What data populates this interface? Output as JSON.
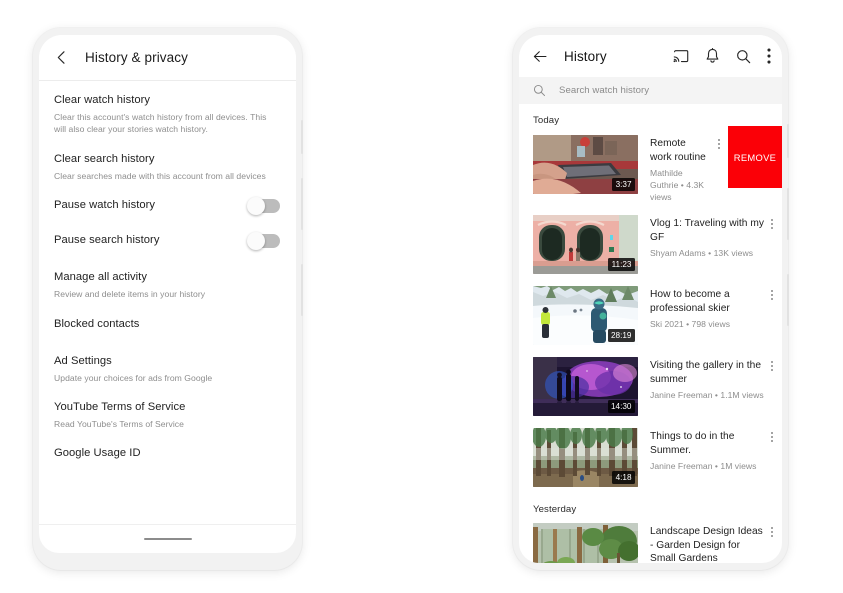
{
  "left_phone": {
    "header": {
      "title": "History & privacy",
      "back_icon": "back-chevron-icon"
    },
    "settings": [
      {
        "title": "Clear watch history",
        "subtitle": "Clear this account's watch history from all devices. This will also clear your stories watch history.",
        "control": "none"
      },
      {
        "title": "Clear search history",
        "subtitle": "Clear searches made with this account from all devices",
        "control": "none"
      },
      {
        "title": "Pause watch history",
        "subtitle": "",
        "control": "toggle",
        "toggle_on": false
      },
      {
        "title": "Pause search history",
        "subtitle": "",
        "control": "toggle",
        "toggle_on": false
      },
      {
        "title": "Manage all activity",
        "subtitle": "Review and delete items in your history",
        "control": "none"
      },
      {
        "title": "Blocked contacts",
        "subtitle": "",
        "control": "none"
      },
      {
        "title": "Ad Settings",
        "subtitle": "Update your choices for ads from Google",
        "control": "none"
      },
      {
        "title": "YouTube Terms of Service",
        "subtitle": "Read YouTube's Terms of Service",
        "control": "none"
      },
      {
        "title": "Google Usage ID",
        "subtitle": "",
        "control": "none"
      }
    ]
  },
  "right_phone": {
    "header": {
      "title": "History",
      "back_icon": "back-arrow-icon",
      "icons": [
        "cast-icon",
        "notifications-bell-icon",
        "search-icon",
        "overflow-menu-icon"
      ]
    },
    "search": {
      "placeholder": "Search watch history",
      "icon": "search-icon"
    },
    "sections": [
      {
        "label": "Today",
        "videos": [
          {
            "title": "Remote work routine",
            "channel": "Mathilde Guthrie",
            "views": "4.3K views",
            "meta": "Mathilde Guthrie • 4.3K views",
            "duration": "3:37",
            "swipe_action": "REMOVE",
            "swipe_action_color": "#fb0007",
            "thumb": "desk-laptop-workspace"
          },
          {
            "title": "Vlog 1: Traveling with my GF",
            "channel": "Shyam Adams",
            "views": "13K views",
            "meta": "Shyam Adams • 13K views",
            "duration": "11:23",
            "thumb": "pink-building-facade"
          },
          {
            "title": "How to become a professional skier",
            "channel": "Ski 2021",
            "views": "798 views",
            "meta": "Ski 2021 • 798 views",
            "duration": "28:19",
            "thumb": "snow-skiers-slope"
          },
          {
            "title": "Visiting the gallery in the summer",
            "channel": "Janine Freeman",
            "views": "1.1M views",
            "meta": "Janine Freeman • 1.1M views",
            "duration": "14:30",
            "thumb": "purple-gallery-installation"
          },
          {
            "title": "Things to do in the Summer.",
            "channel": "Janine Freeman",
            "views": "1M views",
            "meta": "Janine Freeman • 1M views",
            "duration": "4:18",
            "thumb": "misty-pine-forest"
          }
        ]
      },
      {
        "label": "Yesterday",
        "videos": [
          {
            "title": "Landscape Design Ideas - Garden Design for Small Gardens",
            "channel": "",
            "views": "",
            "meta": "",
            "duration": "",
            "thumb": "garden-fence-greenery"
          }
        ]
      }
    ]
  },
  "colors": {
    "accent_red": "#fb0007",
    "frame_grey": "#f2f2f2",
    "text_primary": "#1f1f1f",
    "text_secondary": "#8d8d8d",
    "search_bg": "#f4f4f4"
  }
}
